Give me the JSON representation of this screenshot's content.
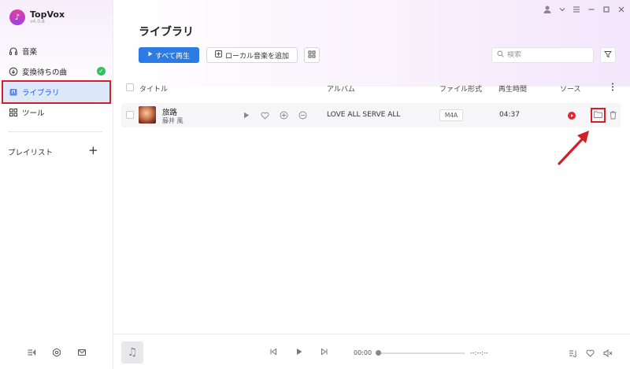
{
  "app": {
    "name": "TopVox",
    "version": "v4.0.8"
  },
  "sidebar": {
    "items": [
      {
        "label": "音楽",
        "icon": "headphones-icon"
      },
      {
        "label": "変換待ちの曲",
        "icon": "download-circle-icon"
      },
      {
        "label": "ライブラリ",
        "icon": "library-icon"
      },
      {
        "label": "ツール",
        "icon": "grid-icon"
      }
    ],
    "playlist_label": "プレイリスト",
    "playlist_add": "+"
  },
  "header": {
    "title": "ライブラリ",
    "play_all": "すべて再生",
    "add_local": "ローカル音楽を追加",
    "search_placeholder": "検索"
  },
  "table": {
    "columns": [
      "タイトル",
      "アルバム",
      "ファイル形式",
      "再生時間",
      "ソース"
    ],
    "rows": [
      {
        "title": "旅路",
        "artist": "藤井 風",
        "album": "LOVE ALL SERVE ALL",
        "format": "M4A",
        "duration": "04:37"
      }
    ]
  },
  "player": {
    "current_time": "00:00",
    "total_time": "--:--:--"
  },
  "colors": {
    "accent": "#2c7be5",
    "highlight": "#d0202a",
    "active_bg": "#dde8fa",
    "source": "#e0262e",
    "check": "#2fc25b"
  }
}
